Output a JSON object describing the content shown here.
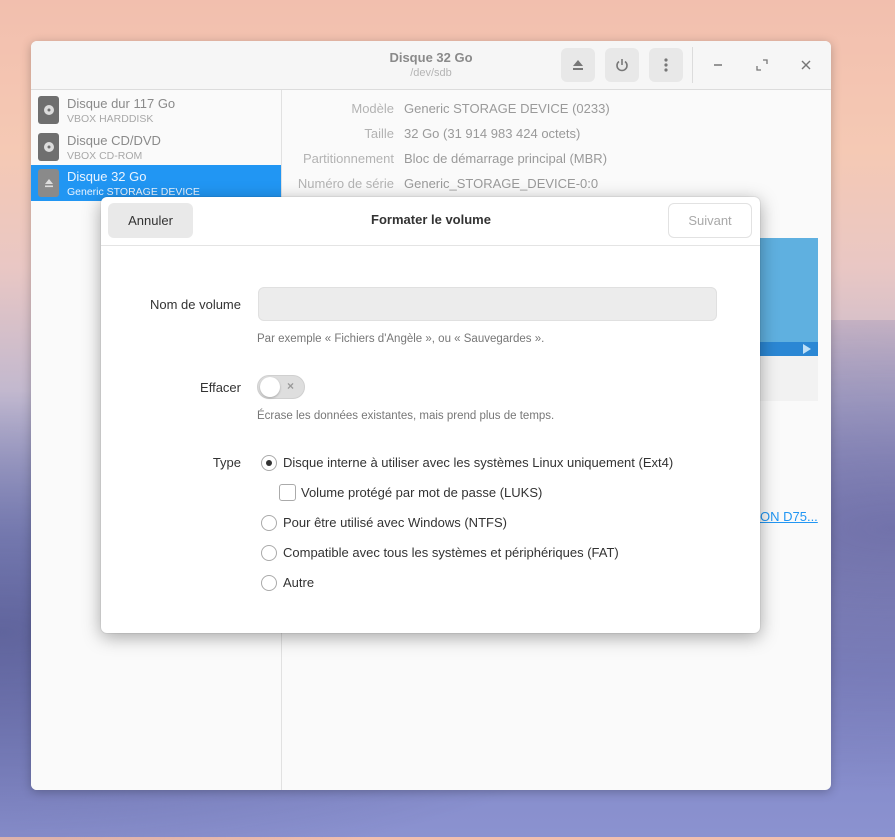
{
  "window": {
    "title": "Disque 32 Go",
    "subtitle": "/dev/sdb"
  },
  "sidebar": {
    "drives": [
      {
        "name": "Disque dur 117 Go",
        "sub": "VBOX HARDDISK",
        "selected": false
      },
      {
        "name": "Disque CD/DVD",
        "sub": "VBOX CD-ROM",
        "selected": false
      },
      {
        "name": "Disque 32 Go",
        "sub": "Generic STORAGE DEVICE",
        "selected": true
      }
    ]
  },
  "properties": [
    {
      "label": "Modèle",
      "value": "Generic STORAGE DEVICE (0233)"
    },
    {
      "label": "Taille",
      "value": "32 Go (31 914 983 424 octets)"
    },
    {
      "label": "Partitionnement",
      "value": "Bloc de démarrage principal (MBR)"
    },
    {
      "label": "Numéro de série",
      "value": "Generic_STORAGE_DEVICE-0:0"
    }
  ],
  "partial_link": "ON D75...",
  "colors": {
    "accent": "#2196f3",
    "volume_bar": "#5fb0e0"
  },
  "dialog": {
    "title": "Formater le volume",
    "cancel_label": "Annuler",
    "next_label": "Suivant",
    "volume_name": {
      "label": "Nom de volume",
      "value": "",
      "hint": "Par exemple « Fichiers d'Angèle », ou « Sauvegardes »."
    },
    "erase": {
      "label": "Effacer",
      "enabled": false,
      "hint": "Écrase les données existantes, mais prend plus de temps."
    },
    "type": {
      "label": "Type",
      "options": [
        {
          "label": "Disque interne à utiliser avec les systèmes Linux uniquement (Ext4)",
          "checked": true
        },
        {
          "label": "Pour être utilisé avec Windows (NTFS)",
          "checked": false
        },
        {
          "label": "Compatible avec tous les systèmes et périphériques (FAT)",
          "checked": false
        },
        {
          "label": "Autre",
          "checked": false
        }
      ],
      "luks": {
        "label": "Volume protégé par mot de passe (LUKS)",
        "checked": false
      }
    }
  }
}
